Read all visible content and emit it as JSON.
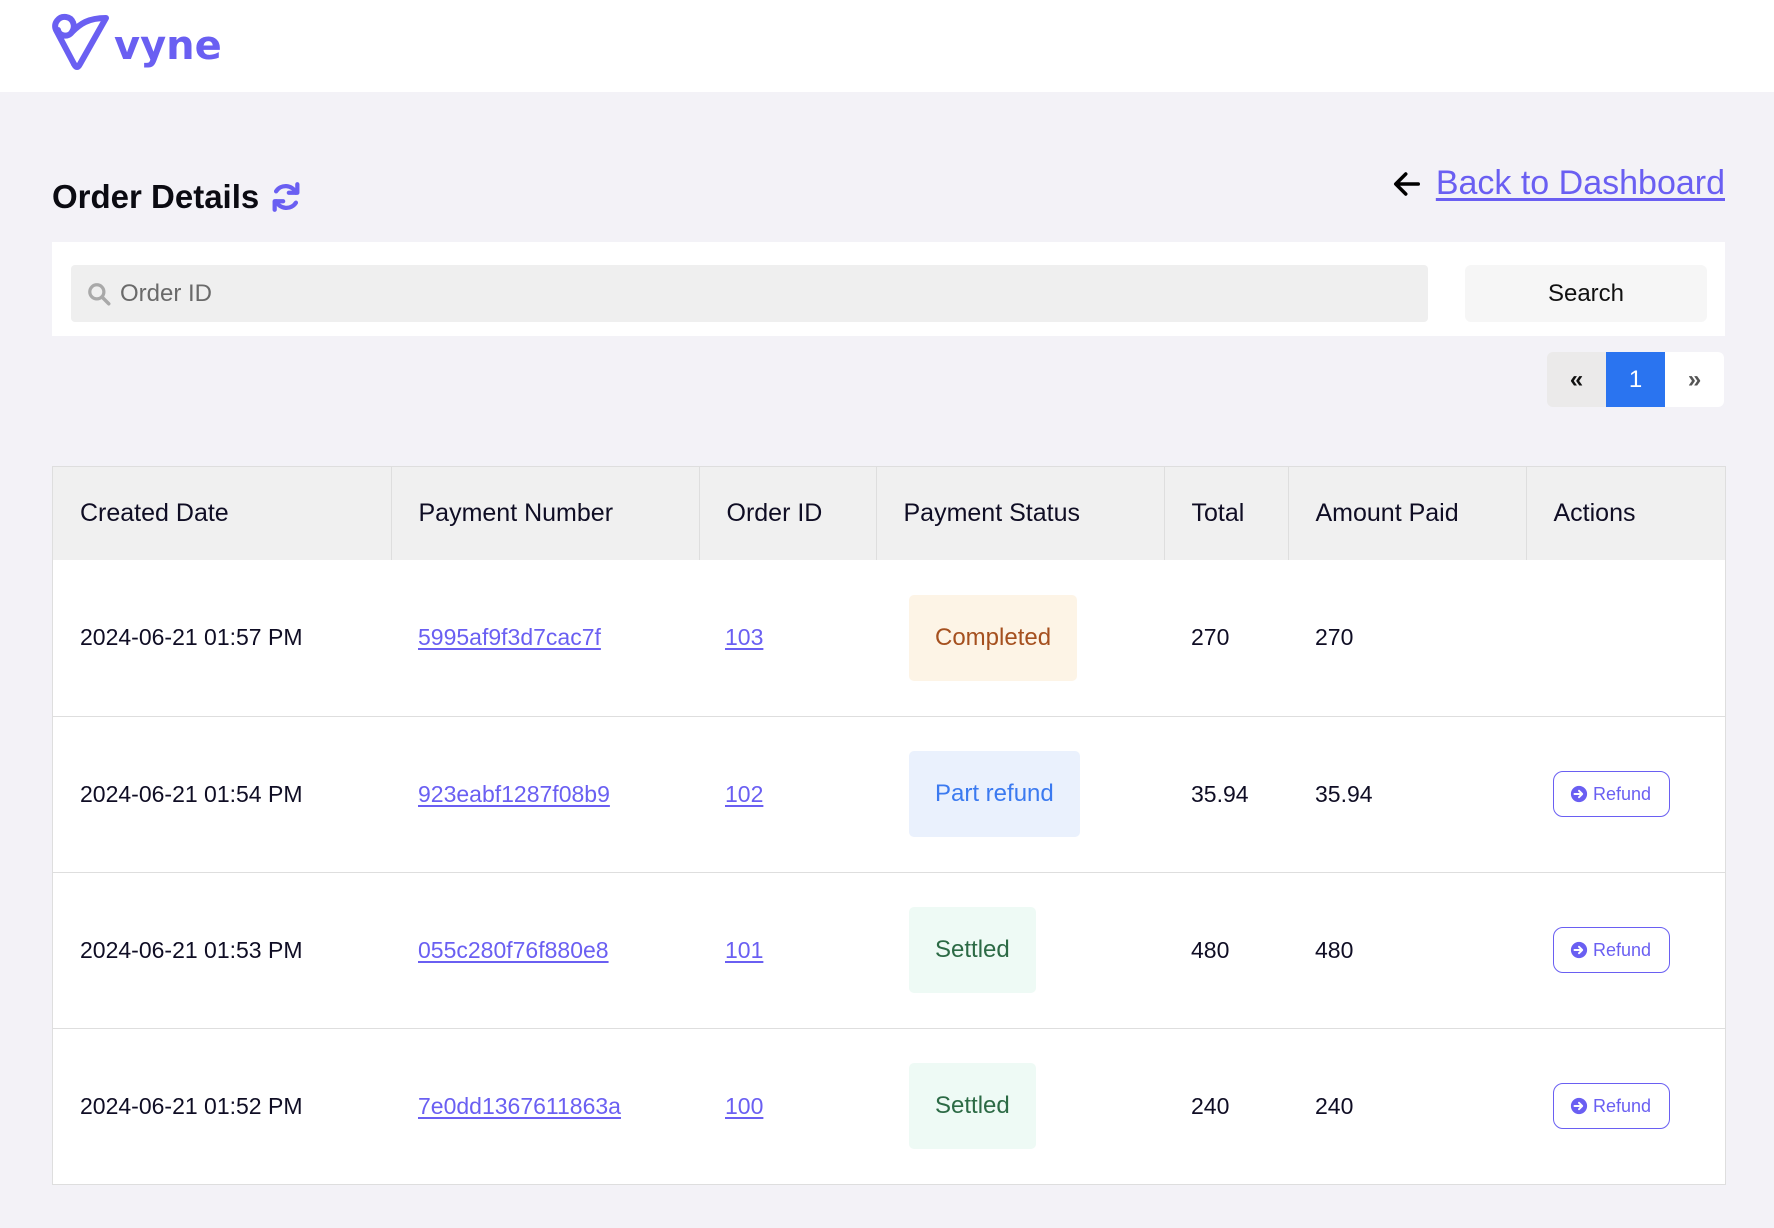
{
  "brand": {
    "name": "vyne",
    "color": "#6a5ff2"
  },
  "page": {
    "title": "Order Details",
    "back_link": "Back to Dashboard"
  },
  "search": {
    "placeholder": "Order ID",
    "value": "",
    "button_label": "Search"
  },
  "pagination": {
    "prev": "«",
    "current": "1",
    "next": "»"
  },
  "table": {
    "headers": [
      "Created Date",
      "Payment Number",
      "Order ID",
      "Payment Status",
      "Total",
      "Amount Paid",
      "Actions"
    ],
    "rows": [
      {
        "created": "2024-06-21 01:57 PM",
        "payment_number": "5995af9f3d7cac7f",
        "order_id": "103",
        "status": "Completed",
        "total": "270",
        "amount_paid": "270",
        "action": ""
      },
      {
        "created": "2024-06-21 01:54 PM",
        "payment_number": "923eabf1287f08b9",
        "order_id": "102",
        "status": "Part refund",
        "total": "35.94",
        "amount_paid": "35.94",
        "action": "Refund"
      },
      {
        "created": "2024-06-21 01:53 PM",
        "payment_number": "055c280f76f880e8",
        "order_id": "101",
        "status": "Settled",
        "total": "480",
        "amount_paid": "480",
        "action": "Refund"
      },
      {
        "created": "2024-06-21 01:52 PM",
        "payment_number": "7e0dd1367611863a",
        "order_id": "100",
        "status": "Settled",
        "total": "240",
        "amount_paid": "240",
        "action": "Refund"
      }
    ]
  },
  "status_colors": {
    "Completed": {
      "bg": "#fdf4e6",
      "fg": "#a5501f"
    },
    "Part refund": {
      "bg": "#eaf1fd",
      "fg": "#3b7af0"
    },
    "Settled": {
      "bg": "#eefaf5",
      "fg": "#2c6a45"
    }
  }
}
